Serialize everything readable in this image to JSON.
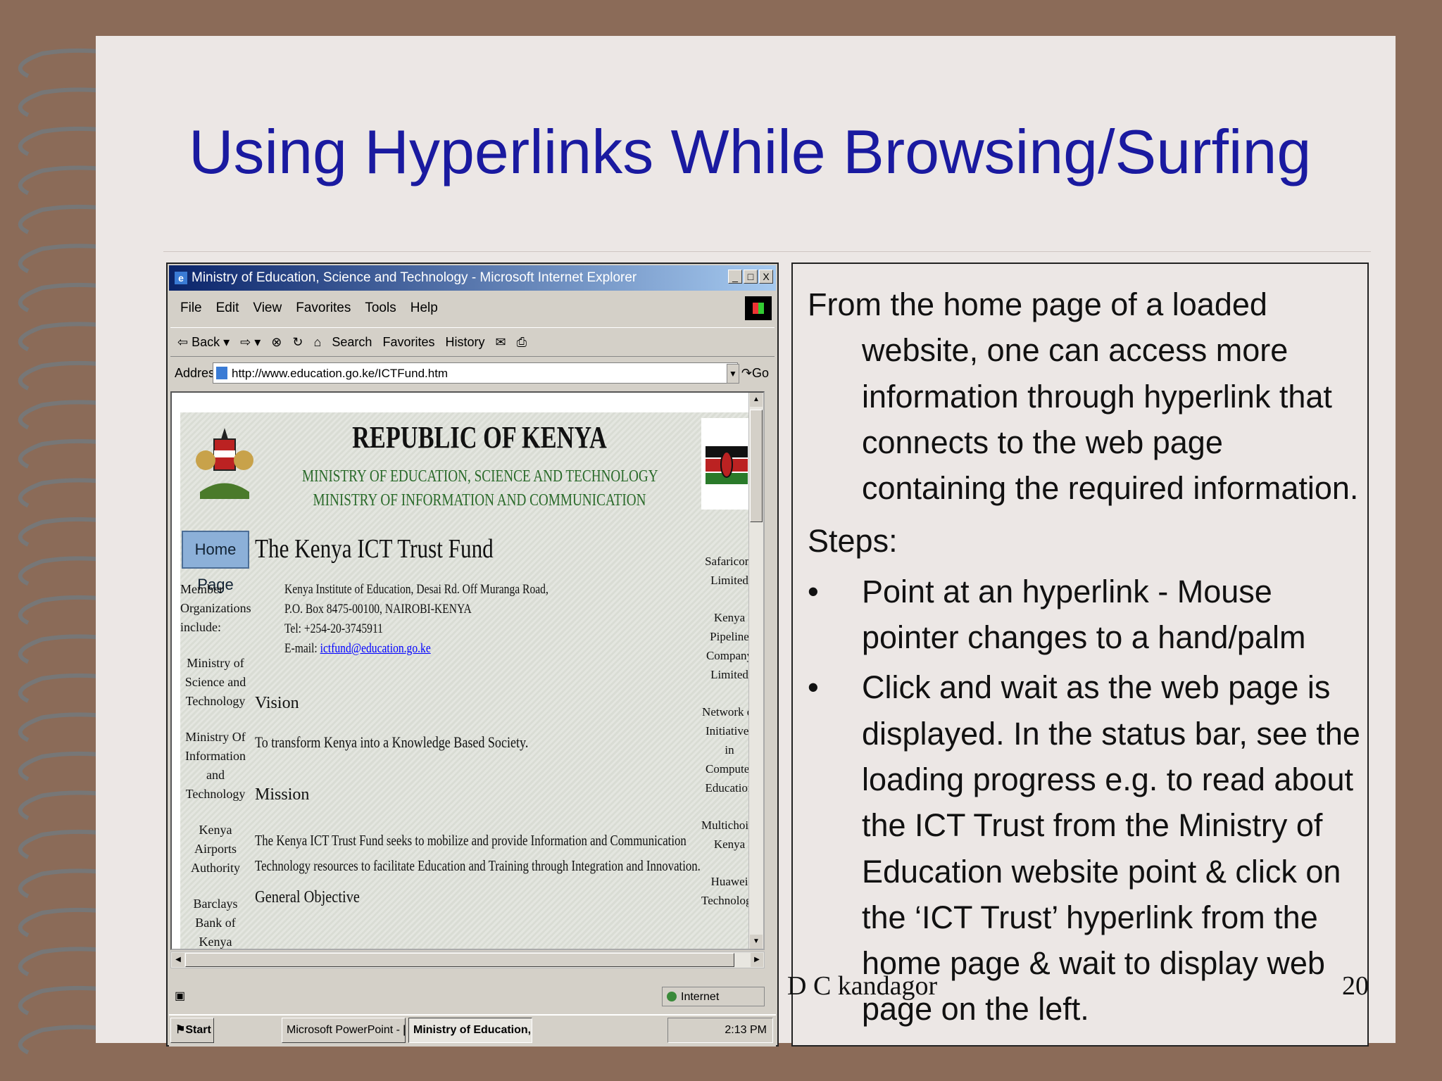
{
  "slide": {
    "title": "Using Hyperlinks While Browsing/Surfing",
    "footer_author": "D C kandagor",
    "page_number": "20"
  },
  "browser": {
    "window_title": "Ministry of Education, Science and Technology - Microsoft Internet Explorer",
    "window_buttons": [
      "_",
      "□",
      "X"
    ],
    "menu": [
      "File",
      "Edit",
      "View",
      "Favorites",
      "Tools",
      "Help"
    ],
    "toolbar": {
      "back": "⇦ Back ▾",
      "forward": "⇨ ▾",
      "search": "Search",
      "favorites": "Favorites",
      "history": "History"
    },
    "address_label": "Address",
    "address_value": "http://www.education.go.ke/ICTFund.htm",
    "go_label": "Go",
    "status_zone": "Internet",
    "taskbar": {
      "start": "Start",
      "task1": "Microsoft PowerPoint - [se...",
      "task2": "Ministry of Education,...",
      "clock": "2:13 PM"
    },
    "webpage": {
      "heading": "REPUBLIC OF KENYA",
      "ministry1": "MINISTRY OF EDUCATION, SCIENCE AND TECHNOLOGY",
      "ministry2": "MINISTRY OF INFORMATION AND COMMUNICATION",
      "home_button": "Home Page",
      "fund_title": "The Kenya ICT Trust Fund",
      "left_members": [
        "Member Organizations include:",
        "Ministry of Science and Technology",
        "Ministry Of Information and Technology",
        "Kenya Airports Authority",
        "Barclays Bank of Kenya"
      ],
      "right_members": [
        "Safaricom Limited",
        "Kenya Pipeline Company Limited",
        "Network of Initiatives in Computer Education",
        "Multichoice Kenya",
        "Huawei Technologie"
      ],
      "address_lines": [
        "Kenya Institute of Education, Desai Rd. Off Muranga Road,",
        "P.O. Box 8475-00100, NAIROBI-KENYA",
        "Tel: +254-20-3745911"
      ],
      "email_label": "E-mail: ",
      "email": "ictfund@education.go.ke",
      "vision_heading": "Vision",
      "vision_text": "To transform Kenya into a Knowledge Based Society.",
      "mission_heading": "Mission",
      "mission_line1": "The Kenya ICT Trust Fund seeks to mobilize and provide Information and Communication",
      "mission_line2": "Technology resources to facilitate Education and Training through Integration and Innovation.",
      "objective_heading": "General Objective"
    }
  },
  "panel": {
    "intro": "From the home page of a loaded website, one can access more information through hyperlink that connects to the web page containing the required information.",
    "steps_label": "Steps:",
    "bullet_symbol": "•",
    "bullets": [
      "Point at an hyperlink - Mouse pointer changes to a hand/palm",
      "Click and wait as the web page is displayed. In the status bar, see the loading progress e.g. to read about the ICT Trust from the Ministry of Education website point & click on the ‘ICT Trust’ hyperlink from the home page & wait to display web page on the left."
    ]
  }
}
